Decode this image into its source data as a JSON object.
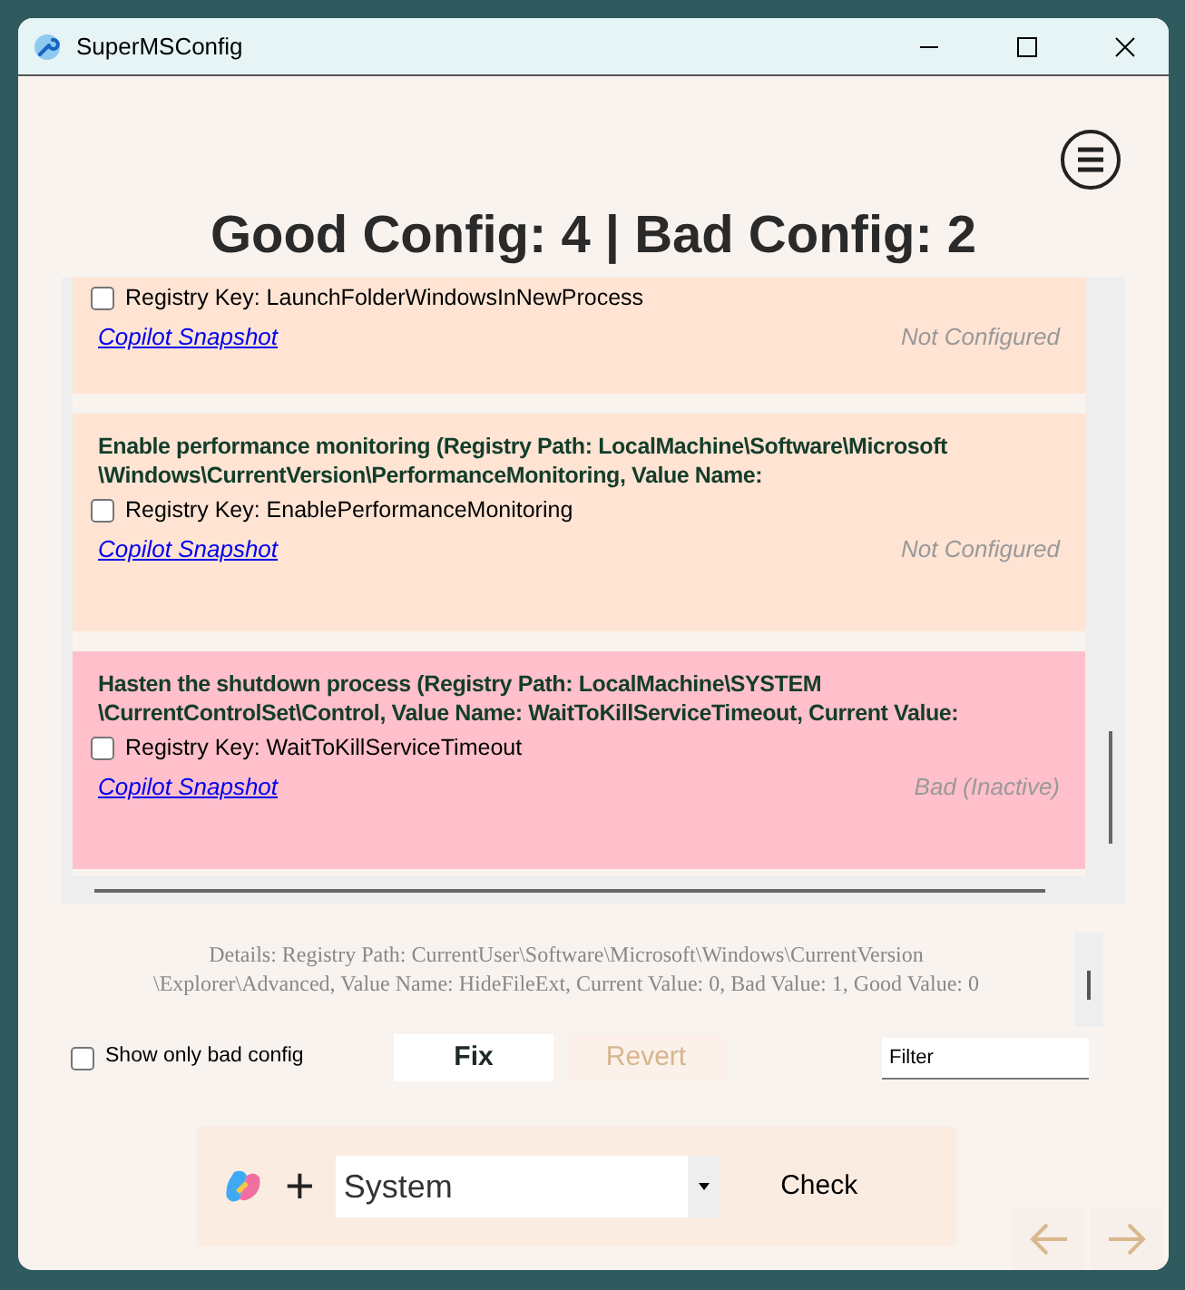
{
  "window": {
    "title": "SuperMSConfig"
  },
  "summary": "Good Config: 4 | Bad Config: 2",
  "items": [
    {
      "kind": "not_configured",
      "key": "Registry Key: LaunchFolderWindowsInNewProcess",
      "checked": false,
      "link": "Copilot Snapshot",
      "state_text": "Not Configured"
    },
    {
      "kind": "not_configured",
      "title_lines": [
        "Enable performance monitoring (Registry Path: LocalMachine\\Software\\Microsoft",
        "\\Windows\\CurrentVersion\\PerformanceMonitoring, Value Name:"
      ],
      "key": "Registry Key: EnablePerformanceMonitoring",
      "checked": false,
      "link": "Copilot Snapshot",
      "state_text": "Not Configured"
    },
    {
      "kind": "bad",
      "title_lines": [
        "Hasten the shutdown process (Registry Path: LocalMachine\\SYSTEM",
        "\\CurrentControlSet\\Control, Value Name: WaitToKillServiceTimeout, Current Value:"
      ],
      "key": "Registry Key: WaitToKillServiceTimeout",
      "checked": false,
      "link": "Copilot Snapshot",
      "state_text": "Bad (Inactive)"
    }
  ],
  "details_lines": [
    "Details: Registry Path: CurrentUser\\Software\\Microsoft\\Windows\\CurrentVersion",
    "\\Explorer\\Advanced, Value Name: HideFileExt, Current Value: 0, Bad Value: 1, Good Value: 0"
  ],
  "show_only_bad": {
    "label": "Show only bad config",
    "checked": false
  },
  "buttons": [
    {
      "label": "Fix",
      "disabled": false
    },
    {
      "label": "Revert",
      "disabled": true
    }
  ],
  "filter": {
    "value": "Filter"
  },
  "plus": "+",
  "category": {
    "value": "System"
  },
  "check_button": "Check"
}
